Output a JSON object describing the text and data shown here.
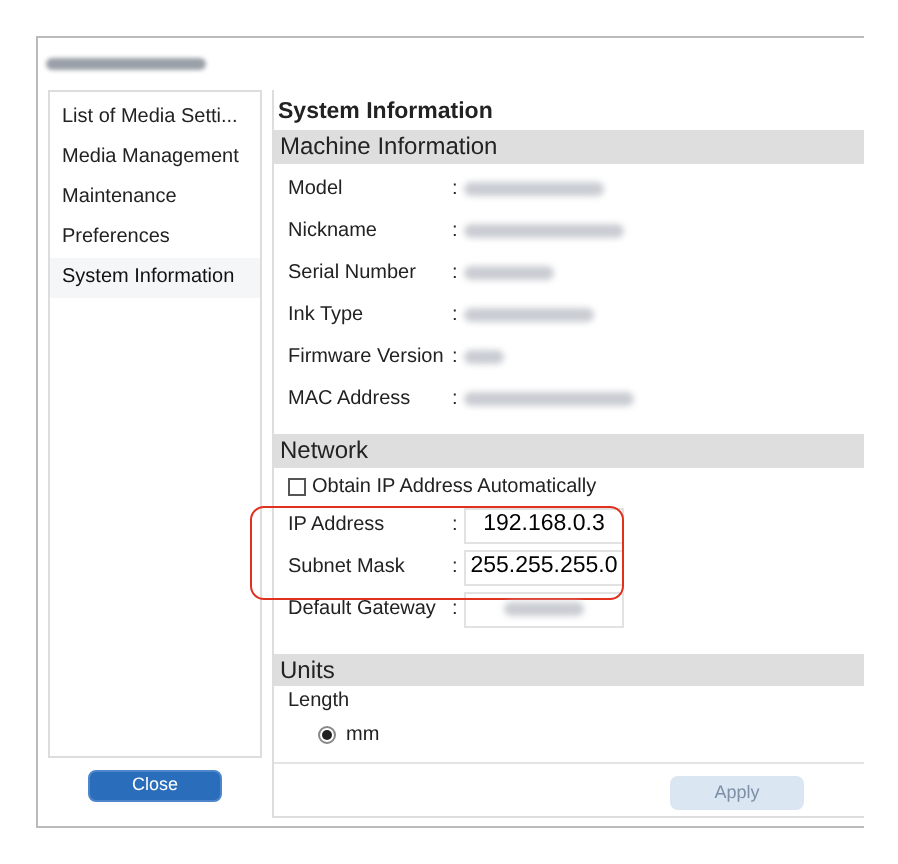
{
  "window": {
    "title_redacted": true
  },
  "sidebar": {
    "items": [
      {
        "label": "List of Media Setti...",
        "selected": false
      },
      {
        "label": "Media Management",
        "selected": false
      },
      {
        "label": "Maintenance",
        "selected": false
      },
      {
        "label": "Preferences",
        "selected": false
      },
      {
        "label": "System Information",
        "selected": true
      }
    ]
  },
  "close_button": "Close",
  "page_title": "System Information",
  "machine_information": {
    "heading": "Machine Information",
    "rows": [
      {
        "label": "Model",
        "separator": ":",
        "redacted": true
      },
      {
        "label": "Nickname",
        "separator": ":",
        "redacted": true
      },
      {
        "label": "Serial Number",
        "separator": ":",
        "redacted": true
      },
      {
        "label": "Ink Type",
        "separator": ":",
        "redacted": true
      },
      {
        "label": "Firmware Version",
        "separator": ":",
        "redacted": true
      },
      {
        "label": "MAC Address",
        "separator": ":",
        "redacted": true
      }
    ]
  },
  "network": {
    "heading": "Network",
    "obtain_automatically": {
      "label": "Obtain IP Address Automatically",
      "checked": false
    },
    "fields": [
      {
        "label": "IP Address",
        "separator": ":",
        "value": "192.168.0.3",
        "highlighted": true
      },
      {
        "label": "Subnet Mask",
        "separator": ":",
        "value": "255.255.255.0",
        "highlighted": true
      },
      {
        "label": "Default Gateway",
        "separator": ":",
        "redacted": true,
        "highlighted": false
      }
    ]
  },
  "units": {
    "heading": "Units",
    "group": "Length",
    "options": [
      {
        "label": "mm",
        "selected": true
      }
    ]
  },
  "apply_button": {
    "label": "Apply",
    "disabled": true
  }
}
